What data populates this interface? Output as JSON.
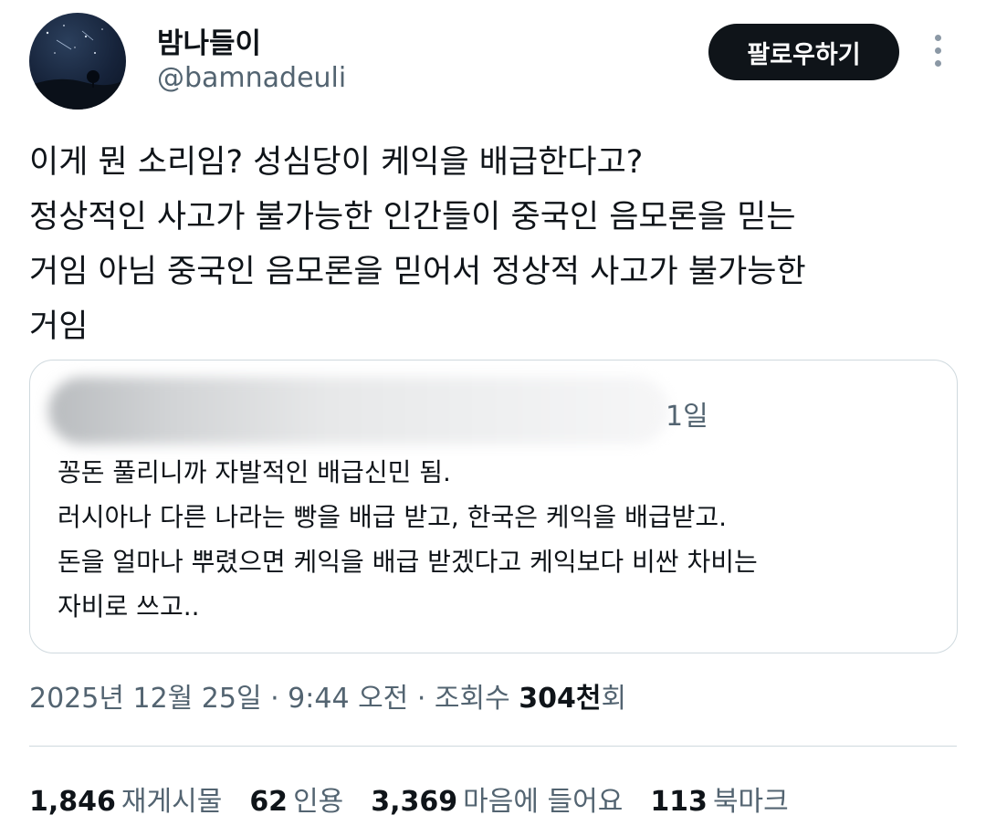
{
  "author": {
    "display_name": "밤나들이",
    "handle": "@bamnadeuli",
    "avatar_icon": "night-sky-avatar"
  },
  "follow_button_label": "팔로우하기",
  "more_icon": "more-vertical-icon",
  "tweet_text": "이게 뭔 소리임? 성심당이 케익을 배급한다고?\n정상적인 사고가 불가능한 인간들이 중국인 음모론을 믿는\n거임 아님 중국인 음모론을 믿어서 정상적 사고가 불가능한\n거임",
  "quote": {
    "date": "1일",
    "text": "꽁돈 풀리니까 자발적인 배급신민 됨.\n러시아나 다른 나라는 빵을 배급 받고, 한국은 케익을 배급받고.\n돈을 얼마나 뿌렸으면 케익을 배급 받겠다고 케익보다 비싼 차비는\n자비로 쓰고.."
  },
  "meta": {
    "timestamp": "2025년 12월 25일 · 9:44 오전 · 조회수 ",
    "views": "304천",
    "views_suffix": "회"
  },
  "stats": [
    {
      "num": "1,846",
      "label": "재게시물"
    },
    {
      "num": "62",
      "label": "인용"
    },
    {
      "num": "3,369",
      "label": "마음에 들어요"
    },
    {
      "num": "113",
      "label": "북마크"
    }
  ],
  "colors": {
    "text_primary": "#0f1419",
    "text_secondary": "#536471",
    "border": "#cfd9de",
    "button_bg": "#0f1419"
  }
}
